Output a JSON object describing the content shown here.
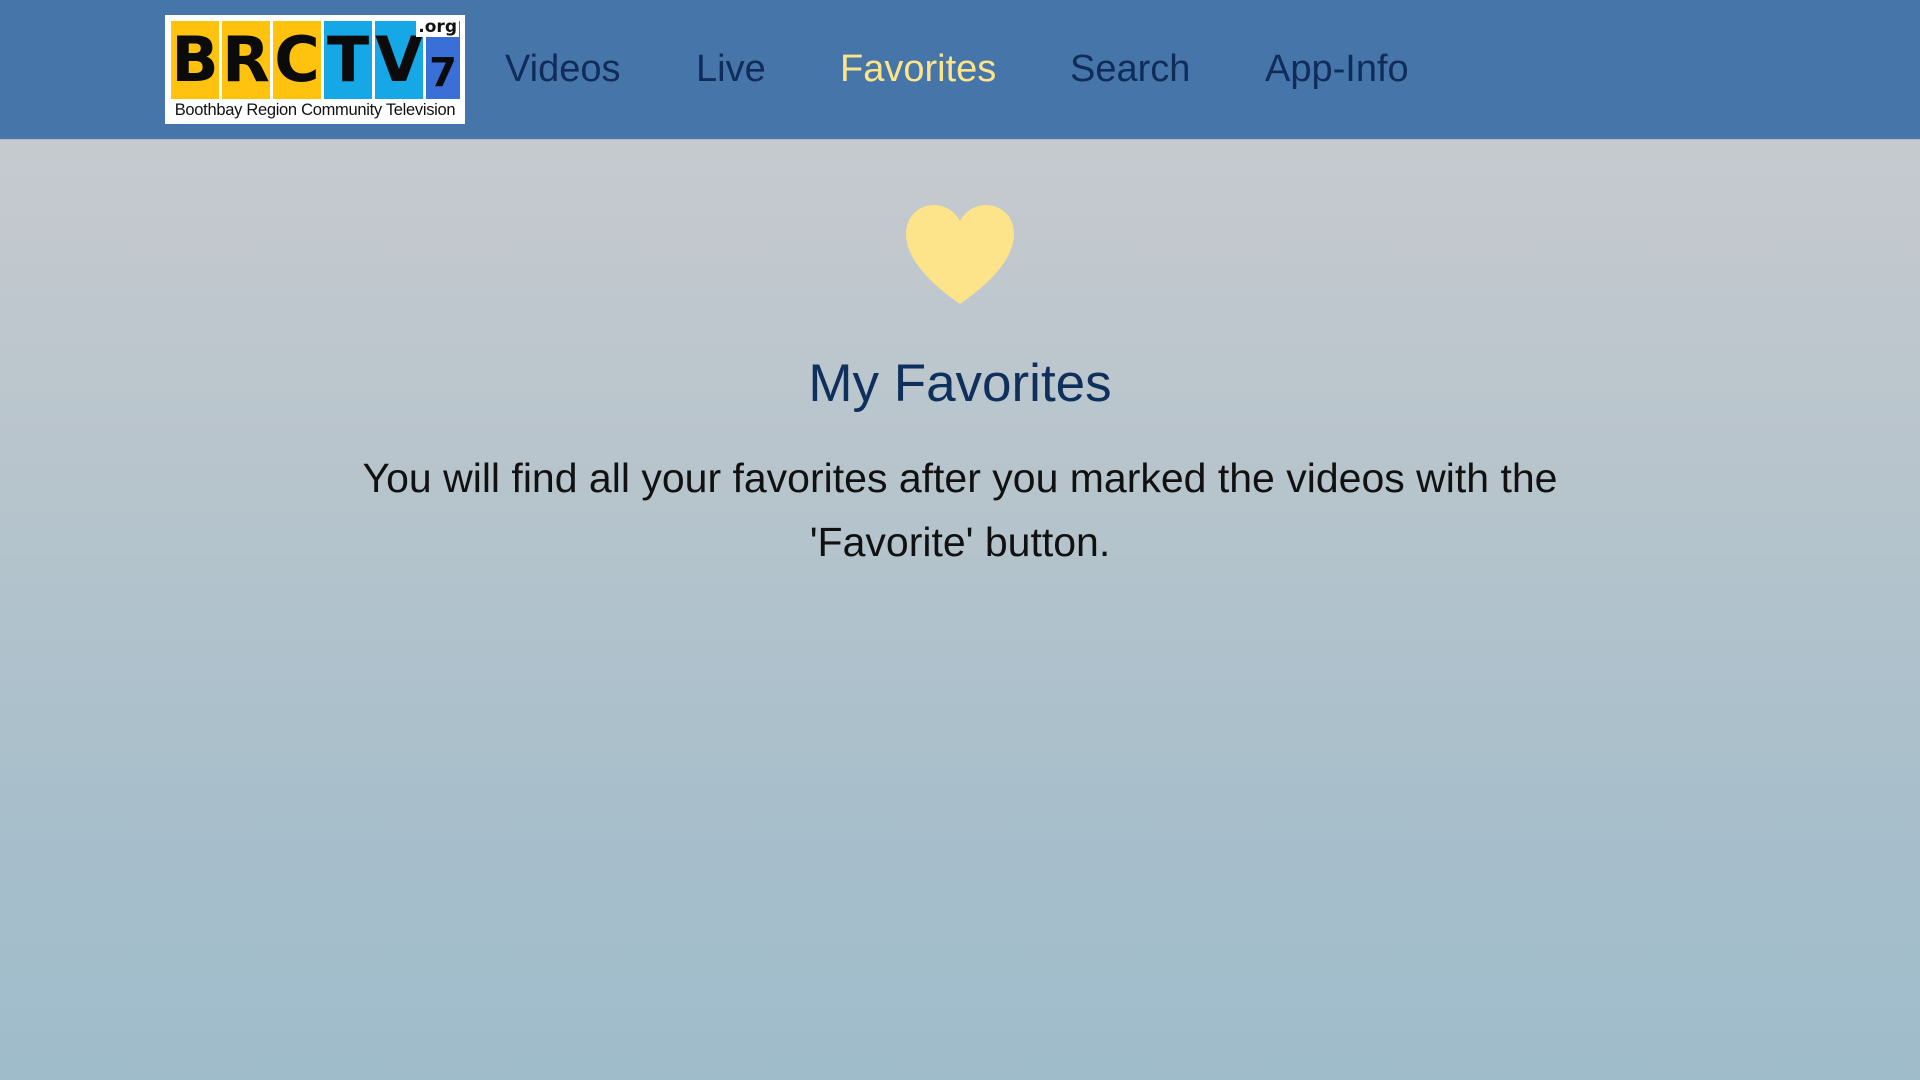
{
  "logo": {
    "letters": [
      "B",
      "R",
      "C",
      "T",
      "V",
      "7"
    ],
    "suffix": ".org",
    "tagline": "Boothbay Region Community Television"
  },
  "nav": {
    "items": [
      {
        "label": "Videos",
        "active": false
      },
      {
        "label": "Live",
        "active": false
      },
      {
        "label": "Favorites",
        "active": true
      },
      {
        "label": "Search",
        "active": false
      },
      {
        "label": "App-Info",
        "active": false
      }
    ]
  },
  "main": {
    "icon": "heart-icon",
    "title": "My Favorites",
    "message": "You will find all your favorites after you marked the videos with the 'Favorite' button."
  },
  "colors": {
    "navbar": "#4676a9",
    "nav_text": "#102c5a",
    "nav_active": "#fde48a",
    "heart": "#fde48a",
    "title": "#0f2f5c"
  }
}
